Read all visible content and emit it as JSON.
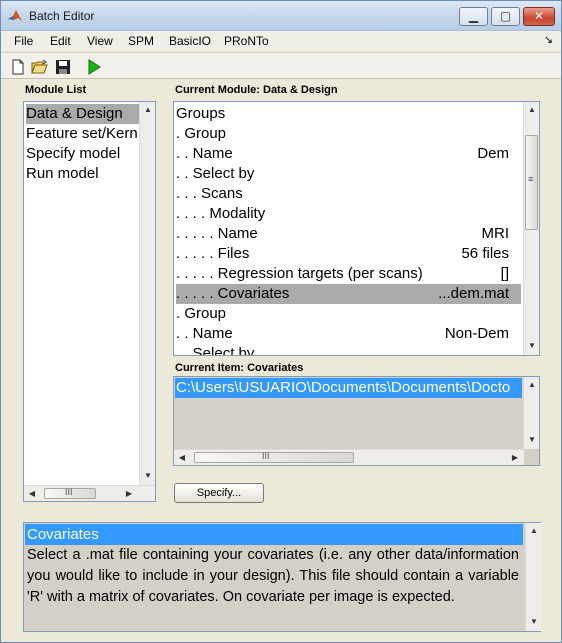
{
  "window": {
    "title": "Batch Editor"
  },
  "menu": {
    "items": [
      "File",
      "Edit",
      "View",
      "SPM",
      "BasicIO",
      "PRoNTo"
    ],
    "overflow_arrow": "↘"
  },
  "toolbar": {
    "icons": [
      "new-file-icon",
      "open-folder-icon",
      "save-icon",
      "run-icon"
    ]
  },
  "module_list": {
    "label": "Module List",
    "items": [
      "Data & Design",
      "Feature set/Kern",
      "Specify model",
      "Run model"
    ],
    "selected_index": 0
  },
  "current_module": {
    "label": "Current Module: Data & Design",
    "rows": [
      {
        "text": "Groups",
        "value": ""
      },
      {
        "text": ". Group",
        "value": ""
      },
      {
        "text": ". . Name",
        "value": "Dem"
      },
      {
        "text": ". . Select by",
        "value": ""
      },
      {
        "text": ". . . Scans",
        "value": ""
      },
      {
        "text": ". . . . Modality",
        "value": ""
      },
      {
        "text": ". . . . . Name",
        "value": "MRI"
      },
      {
        "text": ". . . . . Files",
        "value": "56 files"
      },
      {
        "text": ". . . . . Regression targets (per scans)",
        "value": "[]"
      },
      {
        "text": ". . . . . Covariates",
        "value": "...dem.mat"
      },
      {
        "text": ". Group",
        "value": ""
      },
      {
        "text": ". . Name",
        "value": "Non-Dem"
      },
      {
        "text": ". . Select by",
        "value": ""
      }
    ],
    "selected_index": 9
  },
  "current_item": {
    "label": "Current Item: Covariates",
    "value": "C:\\Users\\USUARIO\\Documents\\Documents\\Docto"
  },
  "specify_button": {
    "label": "Specify..."
  },
  "help": {
    "title": "Covariates",
    "body": "Select a .mat file containing your covariates (i.e. any other data/information you would like to include in your design). This file should contain a variable 'R' with a matrix of covariates. On covariate per image is expected."
  },
  "colors": {
    "selection_blue": "#3399ff",
    "selection_gray": "#aaaaaa",
    "run_green": "#16b816"
  }
}
